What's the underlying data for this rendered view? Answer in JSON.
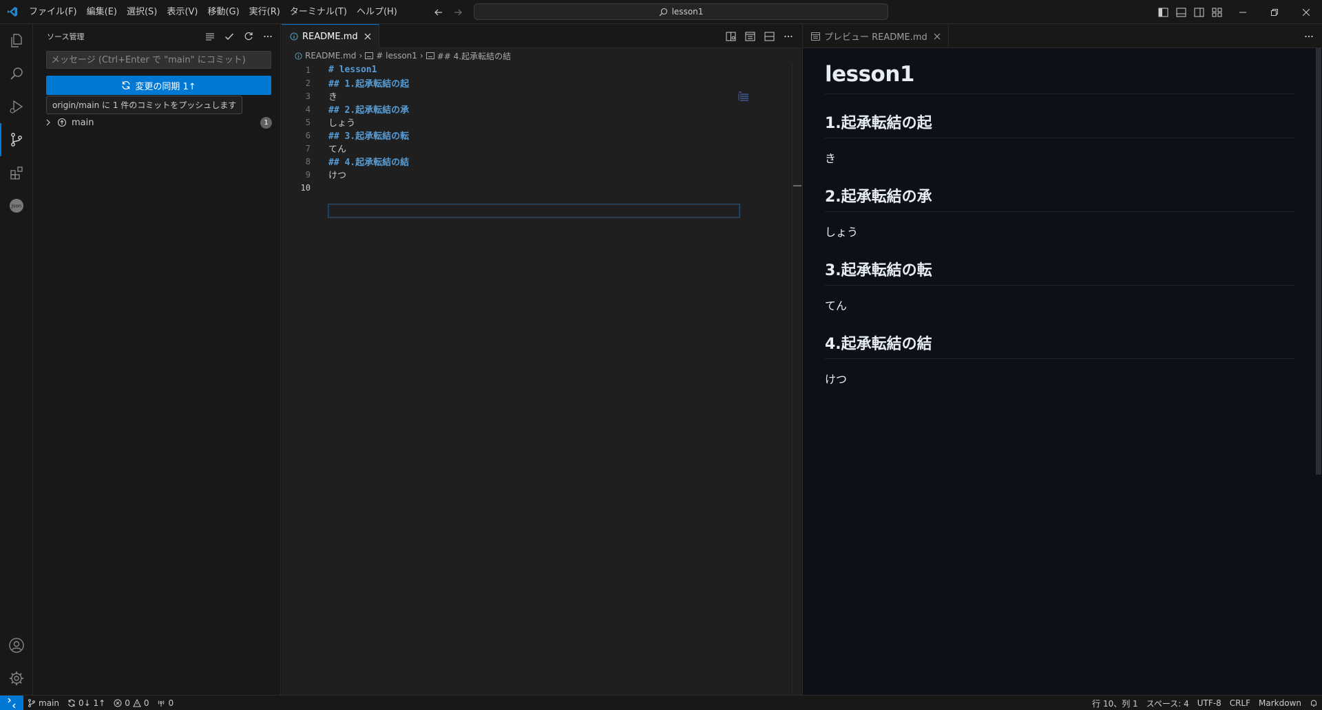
{
  "titlebar": {
    "menu": [
      "ファイル(F)",
      "編集(E)",
      "選択(S)",
      "表示(V)",
      "移動(G)",
      "実行(R)",
      "ターミナル(T)",
      "ヘルプ(H)"
    ],
    "search_text": "lesson1"
  },
  "activity": {
    "items": [
      "files-icon",
      "search-icon",
      "run-debug-icon",
      "source-control-icon",
      "extensions-icon",
      "json-icon"
    ],
    "json_label": "Json",
    "bottom": [
      "account-icon",
      "settings-gear-icon"
    ]
  },
  "sidebar": {
    "title": "ソース管理",
    "commit_placeholder": "メッセージ (Ctrl+Enter で \"main\" にコミット)",
    "sync_label": "変更の同期 1↑",
    "tooltip": "origin/main に 1 件のコミットをプッシュします",
    "branch": "main",
    "branch_count": "1"
  },
  "editor": {
    "tab_label": "README.md",
    "breadcrumbs": [
      "README.md",
      "# lesson1",
      "## 4.起承転結の結"
    ],
    "lines": [
      {
        "no": "1",
        "text": "# lesson1",
        "heading": true
      },
      {
        "no": "2",
        "text": "## 1.起承転結の起",
        "heading": true
      },
      {
        "no": "3",
        "text": "き",
        "heading": false
      },
      {
        "no": "4",
        "text": "## 2.起承転結の承",
        "heading": true
      },
      {
        "no": "5",
        "text": "しょう",
        "heading": false
      },
      {
        "no": "6",
        "text": "## 3.起承転結の転",
        "heading": true
      },
      {
        "no": "7",
        "text": "てん",
        "heading": false
      },
      {
        "no": "8",
        "text": "## 4.起承転結の結",
        "heading": true
      },
      {
        "no": "9",
        "text": "けつ",
        "heading": false
      },
      {
        "no": "10",
        "text": "",
        "heading": false
      }
    ],
    "current_line": "10"
  },
  "preview": {
    "tab_label": "プレビュー README.md",
    "h1": "lesson1",
    "sections": [
      {
        "heading": "1.起承転結の起",
        "body": "き"
      },
      {
        "heading": "2.起承転結の承",
        "body": "しょう"
      },
      {
        "heading": "3.起承転結の転",
        "body": "てん"
      },
      {
        "heading": "4.起承転結の結",
        "body": "けつ"
      }
    ]
  },
  "statusbar": {
    "branch": "main",
    "sync": "0↓ 1↑",
    "errors": "0",
    "warnings": "0",
    "ports": "0",
    "position": "行 10、列 1",
    "spaces": "スペース: 4",
    "encoding": "UTF-8",
    "eol": "CRLF",
    "language": "Markdown"
  },
  "colors": {
    "accent": "#0078d4",
    "heading_code": "#569cd6",
    "preview_bg": "#0d1117"
  }
}
